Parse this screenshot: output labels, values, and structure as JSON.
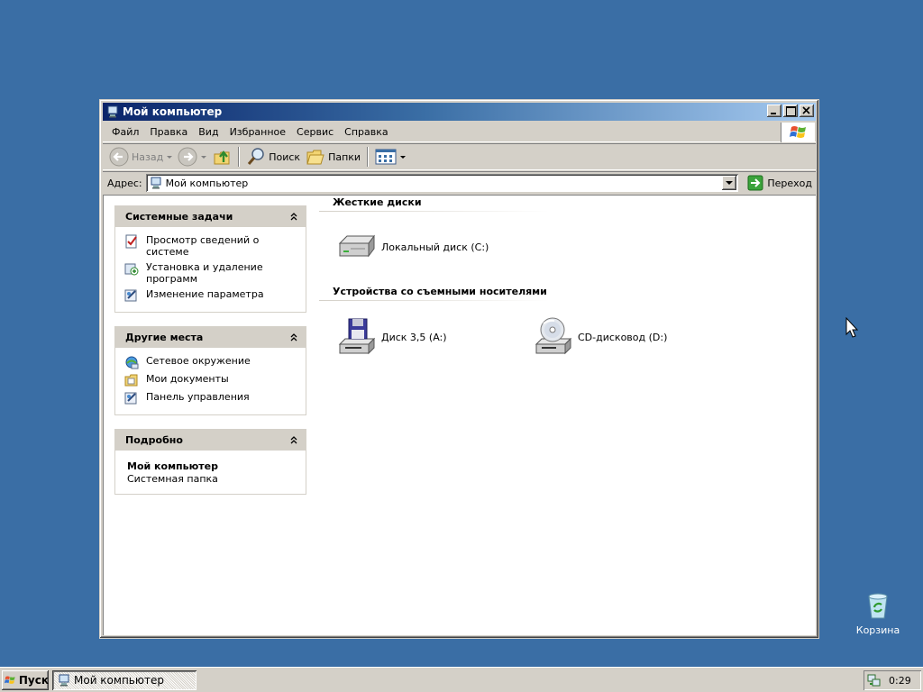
{
  "window": {
    "title": "Мой компьютер",
    "menu": [
      "Файл",
      "Правка",
      "Вид",
      "Избранное",
      "Сервис",
      "Справка"
    ],
    "toolbar": {
      "back": "Назад",
      "search": "Поиск",
      "folders": "Папки"
    },
    "address": {
      "label": "Адрес:",
      "value": "Мой компьютер",
      "go": "Переход"
    }
  },
  "tasks": {
    "system": {
      "title": "Системные задачи",
      "items": [
        "Просмотр сведений о системе",
        "Установка и удаление программ",
        "Изменение параметра"
      ]
    },
    "places": {
      "title": "Другие места",
      "items": [
        "Сетевое окружение",
        "Мои документы",
        "Панель управления"
      ]
    },
    "details": {
      "title": "Подробно",
      "name": "Мой компьютер",
      "type": "Системная папка"
    }
  },
  "content": {
    "hard_drives": {
      "title": "Жесткие диски",
      "items": [
        "Локальный диск (C:)"
      ]
    },
    "removable": {
      "title": "Устройства со съемными носителями",
      "items": [
        "Диск 3,5 (A:)",
        "CD-дисковод (D:)"
      ]
    }
  },
  "desktop": {
    "recycle_bin": "Корзина"
  },
  "taskbar": {
    "start": "Пуск",
    "task": "Мой компьютер",
    "clock": "0:29"
  }
}
